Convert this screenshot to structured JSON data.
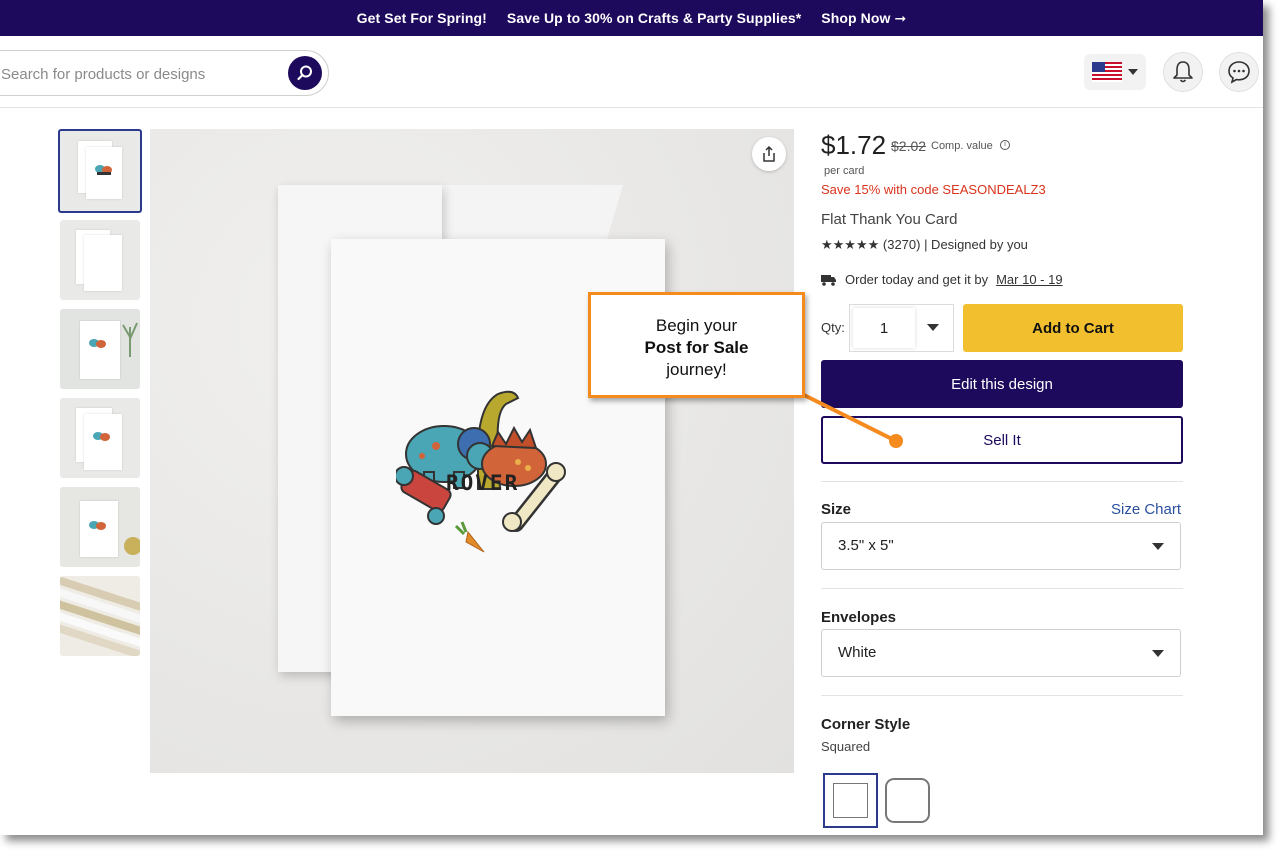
{
  "promo": {
    "line1": "Get Set For Spring!",
    "line2": "Save Up to 30% on Crafts & Party Supplies*",
    "cta": "Shop Now ➞"
  },
  "search": {
    "placeholder": "Search for products or designs"
  },
  "icons": {
    "search": "search-icon",
    "flag": "us-flag-icon",
    "notifications": "bell-icon",
    "chat": "chat-icon",
    "share": "share-icon",
    "truck": "truck-icon"
  },
  "product": {
    "price": "$1.72",
    "old_price": "$2.02",
    "comp_value": "Comp. value",
    "per_card": "per card",
    "promo_code": "Save 15% with code SEASONDEALZ3",
    "title": "Flat Thank You Card",
    "rating": "★★★★★ (3270) | Designed by you",
    "delivery_text": "Order today and get it by",
    "delivery_date": "Mar 10 - 19",
    "card_text": "ROVER"
  },
  "actions": {
    "qty_label": "Qty:",
    "qty_value": "1",
    "add_to_cart": "Add to Cart",
    "edit_design": "Edit this design",
    "sell_it": "Sell It"
  },
  "options": {
    "size_label": "Size",
    "size_chart": "Size Chart",
    "size_value": "3.5\" x 5\"",
    "envelopes_label": "Envelopes",
    "envelopes_value": "White",
    "corner_label": "Corner Style",
    "corner_value": "Squared"
  },
  "callout": {
    "line1": "Begin your",
    "line2": "Post for Sale",
    "line3": "journey!"
  },
  "colors": {
    "brand": "#1d0a5c",
    "cta": "#f2c02e",
    "callout": "#f58a1f",
    "promo_text": "#d9331c"
  }
}
